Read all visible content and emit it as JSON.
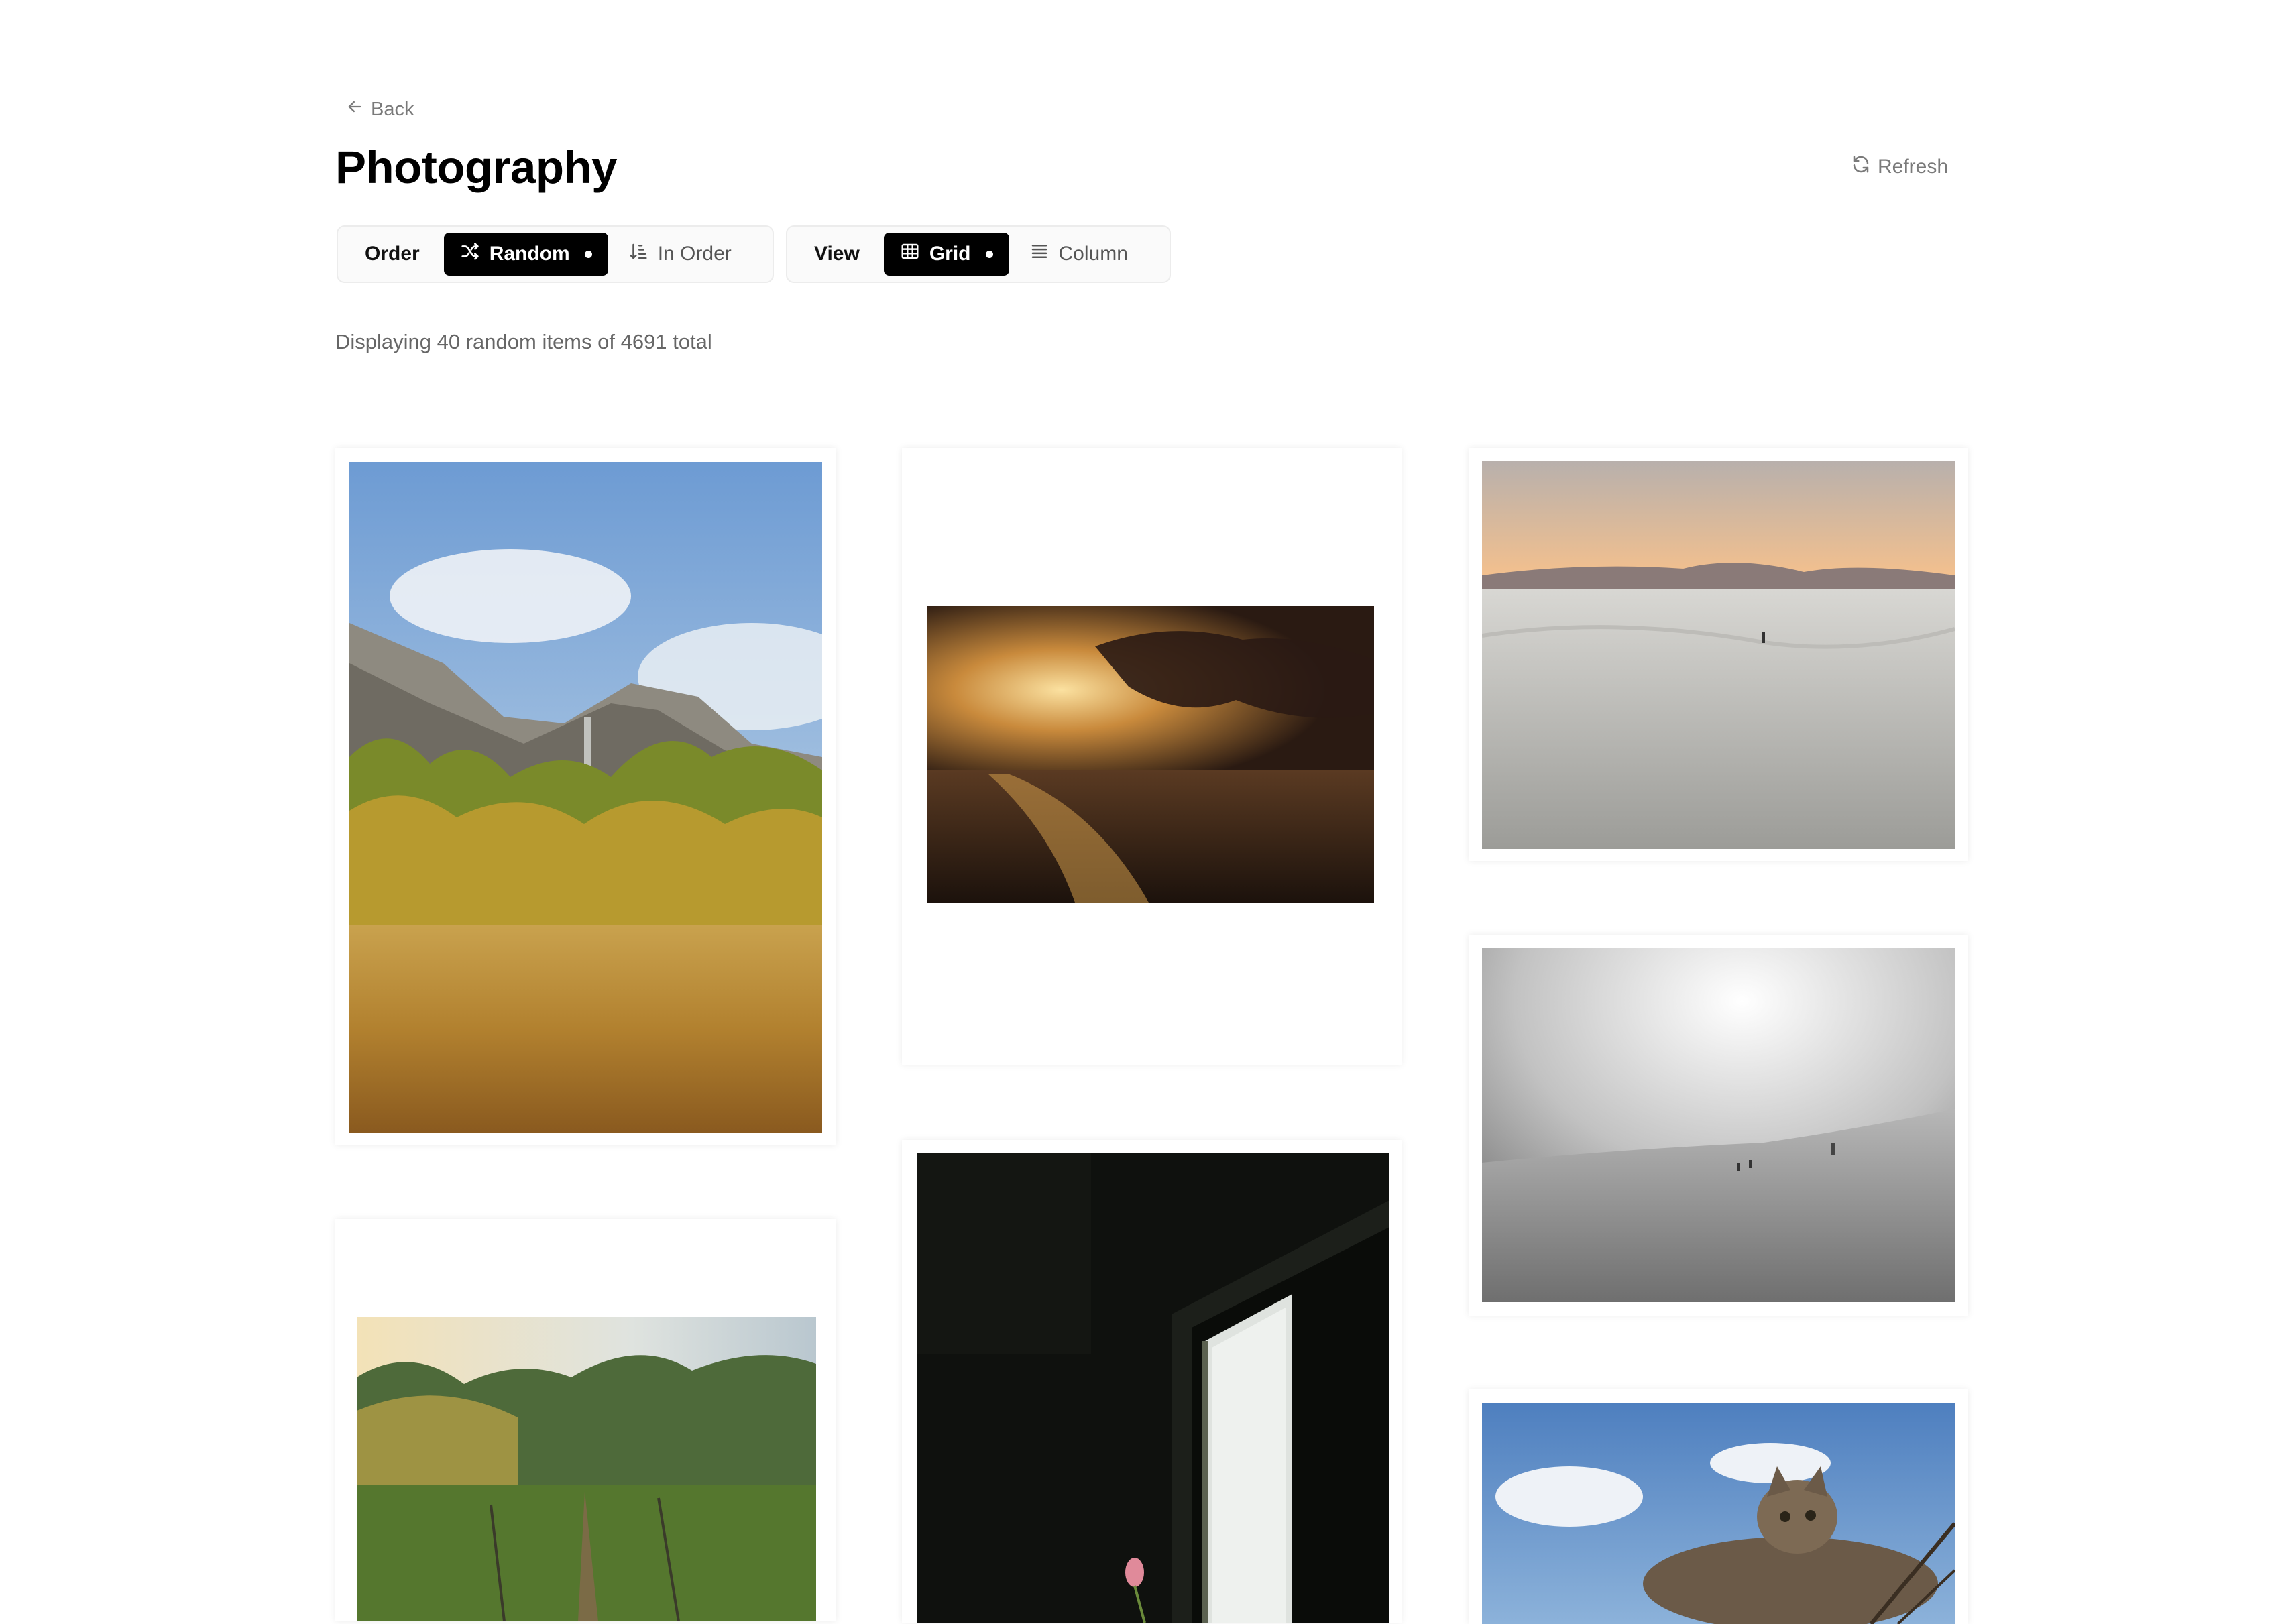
{
  "nav": {
    "back_label": "Back"
  },
  "page": {
    "title": "Photography"
  },
  "toolbar": {
    "refresh_label": "Refresh",
    "order": {
      "label": "Order",
      "random_label": "Random",
      "in_order_label": "In Order"
    },
    "view": {
      "label": "View",
      "grid_label": "Grid",
      "column_label": "Column"
    }
  },
  "status": {
    "text": "Displaying 40 random items of 4691 total"
  },
  "photos": [
    {
      "name": "yosemite-meadow-photo"
    },
    {
      "name": "sea-sunset-photo"
    },
    {
      "name": "white-sand-dunes-photo"
    },
    {
      "name": "snowy-slope-photo"
    },
    {
      "name": "misty-field-sunrise-photo"
    },
    {
      "name": "dark-window-tulip-photo"
    },
    {
      "name": "cat-on-branch-photo"
    }
  ]
}
